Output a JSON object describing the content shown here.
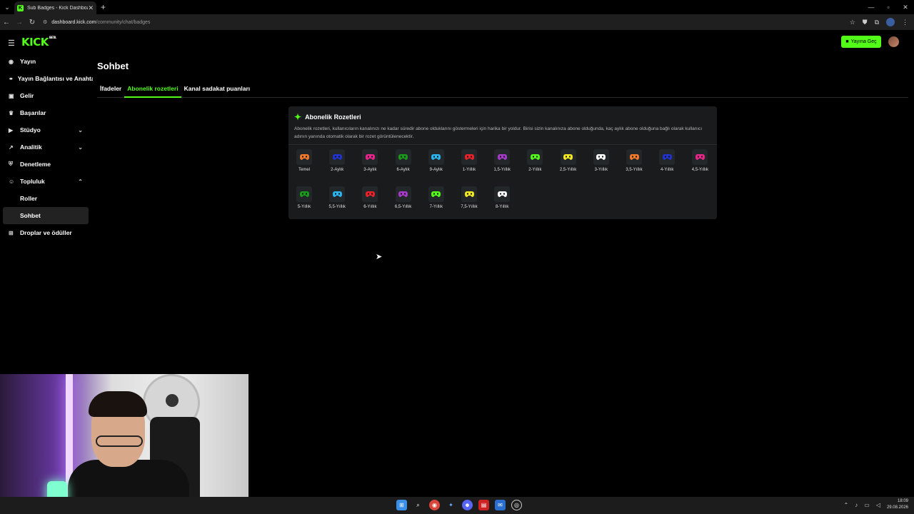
{
  "browser": {
    "tab_title": "Sub Badges - Kick Dashboard",
    "url_host": "dashboard.kick.com",
    "url_path": "/community/chat/badges"
  },
  "header": {
    "logo_text": "KICK",
    "logo_sup": "BETA",
    "go_live_label": "Yayına Geç"
  },
  "sidebar": {
    "items": [
      {
        "label": "Yayın",
        "icon": "broadcast-icon"
      },
      {
        "label": "Yayın Bağlantısı ve Anahtar",
        "icon": "link-icon"
      },
      {
        "label": "Gelir",
        "icon": "money-icon"
      },
      {
        "label": "Başarılar",
        "icon": "trophy-icon"
      },
      {
        "label": "Stüdyo",
        "icon": "camera-icon"
      },
      {
        "label": "Analitik",
        "icon": "chart-icon"
      },
      {
        "label": "Denetleme",
        "icon": "shield-icon"
      },
      {
        "label": "Topluluk",
        "icon": "people-icon"
      },
      {
        "label": "Roller"
      },
      {
        "label": "Sohbet"
      },
      {
        "label": "Droplar ve ödüller",
        "icon": "gift-icon"
      }
    ]
  },
  "main": {
    "page_title": "Sohbet",
    "tabs": [
      {
        "label": "İfadeler"
      },
      {
        "label": "Abonelik rozetleri"
      },
      {
        "label": "Kanal sadakat puanları"
      }
    ]
  },
  "card": {
    "title": "Abonelik Rozetleri",
    "description": "Abonelik rozetleri, kullanıcıların kanalınızı ne kadar süredir abone olduklarını göstermeleri için harika bir yoldur. Birisi sizin kanalınıza abone olduğunda, kaç aylık abone olduğuna bağlı olarak kullanıcı adının yanında otomatik olarak bir rozet görüntülenecektir."
  },
  "badges": [
    {
      "label": "Temel",
      "color": "#f07a2a"
    },
    {
      "label": "2-Aylık",
      "color": "#2233cc"
    },
    {
      "label": "3-Aylık",
      "color": "#e8258a"
    },
    {
      "label": "6-Aylık",
      "color": "#1a9a1a"
    },
    {
      "label": "9-Aylık",
      "color": "#2ab4f0"
    },
    {
      "label": "1-Yıllık",
      "color": "#e8222a"
    },
    {
      "label": "1,5-Yıllık",
      "color": "#a63ac9"
    },
    {
      "label": "2-Yıllık",
      "color": "#53fc18"
    },
    {
      "label": "2,5-Yıllık",
      "color": "#f0e820"
    },
    {
      "label": "3-Yıllık",
      "color": "#ffffff"
    },
    {
      "label": "3,5-Yıllık",
      "color": "#f07a2a"
    },
    {
      "label": "4-Yıllık",
      "color": "#2233cc"
    },
    {
      "label": "4,5-Yıllık",
      "color": "#e8258a"
    },
    {
      "label": "5-Yıllık",
      "color": "#1a9a1a"
    },
    {
      "label": "5,5-Yıllık",
      "color": "#2ab4f0"
    },
    {
      "label": "6-Yıllık",
      "color": "#e8222a"
    },
    {
      "label": "6,5-Yıllık",
      "color": "#a63ac9"
    },
    {
      "label": "7-Yıllık",
      "color": "#53fc18"
    },
    {
      "label": "7,5-Yıllık",
      "color": "#f0e820"
    },
    {
      "label": "8-Yıllık",
      "color": "#ffffff"
    }
  ],
  "taskbar": {
    "time": "18:09",
    "date": "29.08.2026"
  }
}
